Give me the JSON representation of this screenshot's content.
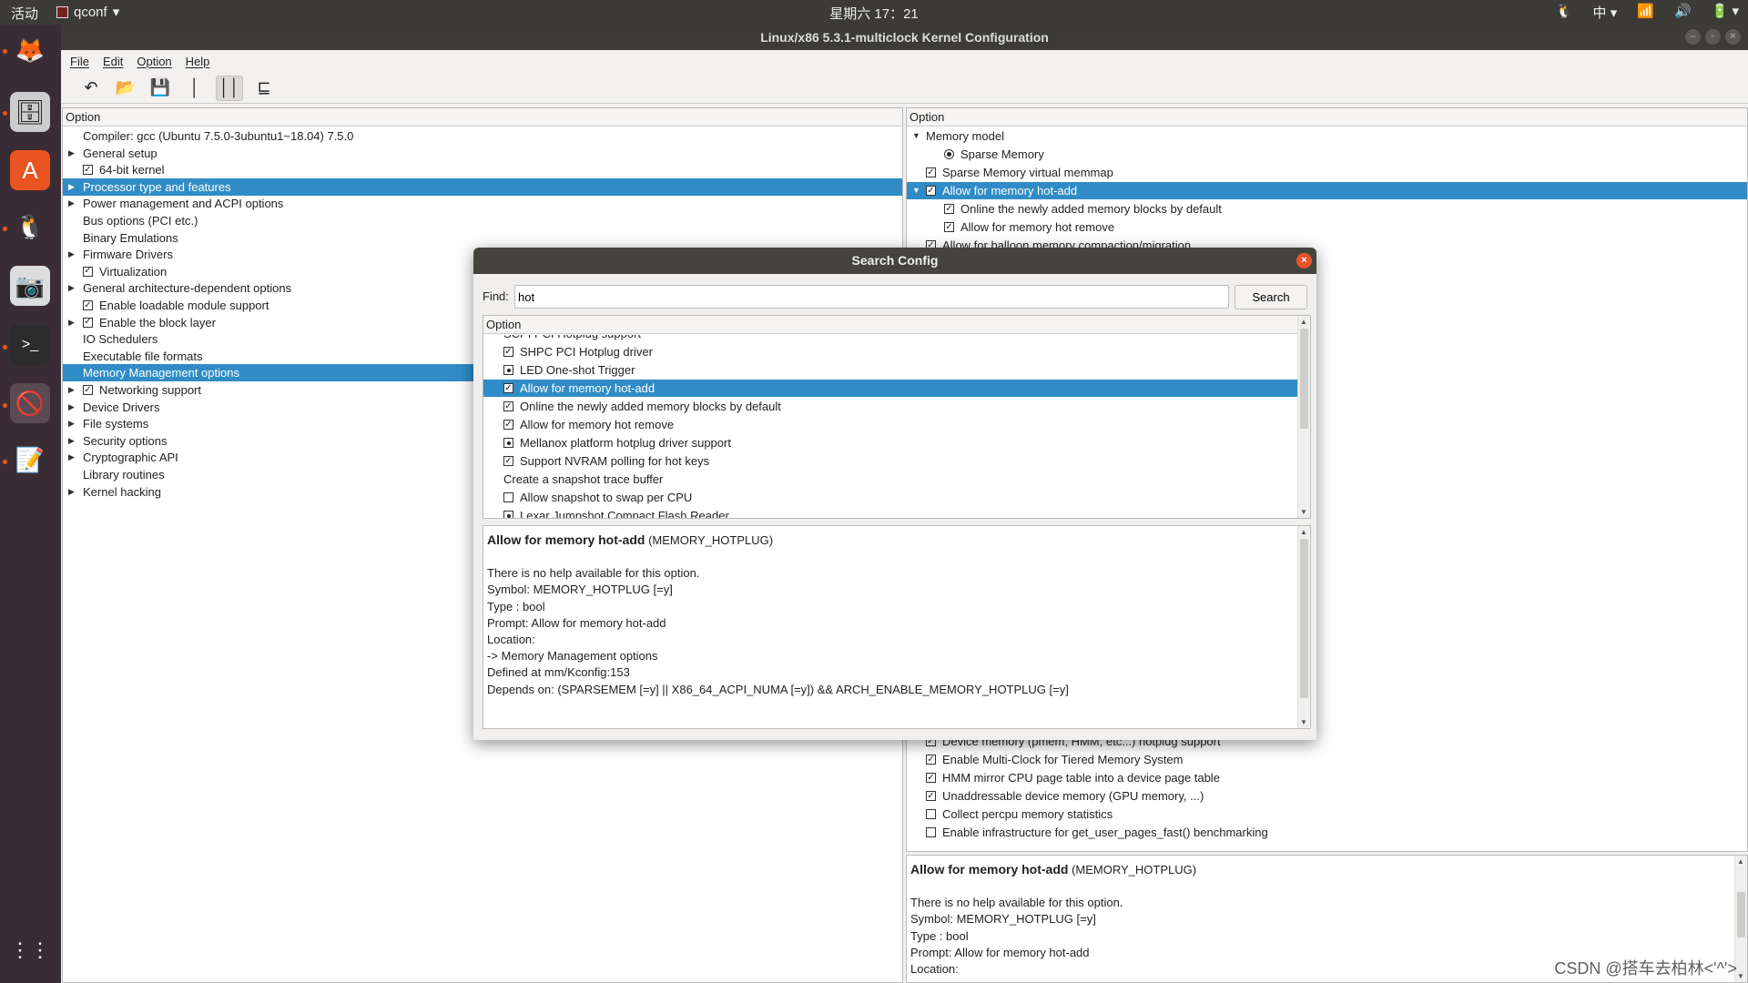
{
  "topbar": {
    "activities": "活动",
    "app_name": "qconf",
    "clock": "星期六 17：21",
    "input_method": "中"
  },
  "window": {
    "title": "Linux/x86 5.3.1-multiclock Kernel Configuration"
  },
  "menu": [
    "File",
    "Edit",
    "Option",
    "Help"
  ],
  "toolbar": {
    "icons": [
      "undo-icon",
      "open-folder-icon",
      "save-icon",
      "single-view-icon",
      "split-view-icon",
      "full-view-icon"
    ],
    "active": "split-view-icon"
  },
  "left": {
    "header": "Option",
    "rows": [
      {
        "label": "Compiler: gcc (Ubuntu 7.5.0-3ubuntu1~18.04) 7.5.0",
        "state": "none",
        "arrow": false
      },
      {
        "label": "General setup",
        "state": "none",
        "arrow": true
      },
      {
        "label": "64-bit kernel",
        "state": "checked",
        "arrow": false
      },
      {
        "label": "Processor type and features",
        "state": "none",
        "arrow": true,
        "selected": true
      },
      {
        "label": "Power management and ACPI options",
        "state": "none",
        "arrow": true
      },
      {
        "label": "Bus options (PCI etc.)",
        "state": "none",
        "arrow": false
      },
      {
        "label": "Binary Emulations",
        "state": "none",
        "arrow": false
      },
      {
        "label": "Firmware Drivers",
        "state": "none",
        "arrow": true
      },
      {
        "label": "Virtualization",
        "state": "checked",
        "arrow": false
      },
      {
        "label": "General architecture-dependent options",
        "state": "none",
        "arrow": true
      },
      {
        "label": "Enable loadable module support",
        "state": "checked",
        "arrow": false
      },
      {
        "label": "Enable the block layer",
        "state": "checked",
        "arrow": true
      },
      {
        "label": "IO Schedulers",
        "state": "none",
        "arrow": false
      },
      {
        "label": "Executable file formats",
        "state": "none",
        "arrow": false
      },
      {
        "label": "Memory Management options",
        "state": "none",
        "arrow": false,
        "selected": true
      },
      {
        "label": "Networking support",
        "state": "checked",
        "arrow": true
      },
      {
        "label": "Device Drivers",
        "state": "none",
        "arrow": true
      },
      {
        "label": "File systems",
        "state": "none",
        "arrow": true
      },
      {
        "label": "Security options",
        "state": "none",
        "arrow": true
      },
      {
        "label": "Cryptographic API",
        "state": "none",
        "arrow": true
      },
      {
        "label": "Library routines",
        "state": "none",
        "arrow": false
      },
      {
        "label": "Kernel hacking",
        "state": "none",
        "arrow": true
      }
    ]
  },
  "right": {
    "header": "Option",
    "rows_top": [
      {
        "label": "Memory model",
        "state": "none",
        "indent": 0,
        "expanded": true
      },
      {
        "label": "Sparse Memory",
        "state": "radio",
        "indent": 1
      },
      {
        "label": "Sparse Memory virtual memmap",
        "state": "checked",
        "indent": 0
      },
      {
        "label": "Allow for memory hot-add",
        "state": "checked",
        "indent": 0,
        "expanded": true,
        "selected": true
      },
      {
        "label": "Online the newly added memory blocks by default",
        "state": "checked",
        "indent": 1
      },
      {
        "label": "Allow for memory hot remove",
        "state": "checked",
        "indent": 1
      },
      {
        "label": "Allow for balloon memory compaction/migration",
        "state": "checked",
        "indent": 0
      }
    ],
    "rows_bottom": [
      {
        "label": "Device memory (pmem, HMM, etc...) hotplug support",
        "state": "checked"
      },
      {
        "label": "Enable Multi-Clock for Tiered Memory System",
        "state": "checked"
      },
      {
        "label": "HMM mirror CPU page table into a device page table",
        "state": "checked"
      },
      {
        "label": "Unaddressable device memory (GPU memory, ...)",
        "state": "checked"
      },
      {
        "label": "Collect percpu memory statistics",
        "state": "unchecked"
      },
      {
        "label": "Enable infrastructure for get_user_pages_fast() benchmarking",
        "state": "unchecked"
      }
    ],
    "help": {
      "title": "Allow for memory hot-add",
      "symbol_tag": "(MEMORY_HOTPLUG)",
      "lines": [
        "There is no help available for this option.",
        "Symbol: MEMORY_HOTPLUG [=y]",
        "Type : bool",
        "Prompt: Allow for memory hot-add",
        "Location:"
      ]
    }
  },
  "dialog": {
    "title": "Search Config",
    "find_label": "Find:",
    "find_value": "hot",
    "search_button": "Search",
    "list_header": "Option",
    "partial_row": "SCPI PCI Hotplug support",
    "rows": [
      {
        "label": "SHPC PCI Hotplug driver",
        "state": "checked"
      },
      {
        "label": "LED One-shot Trigger",
        "state": "module"
      },
      {
        "label": "Allow for memory hot-add",
        "state": "checked",
        "selected": true
      },
      {
        "label": "Online the newly added memory blocks by default",
        "state": "checked"
      },
      {
        "label": "Allow for memory hot remove",
        "state": "checked"
      },
      {
        "label": "Mellanox platform hotplug driver support",
        "state": "module"
      },
      {
        "label": "Support NVRAM polling for hot keys",
        "state": "checked"
      },
      {
        "label": "Create a snapshot trace buffer",
        "state": "none"
      },
      {
        "label": "Allow snapshot to swap per CPU",
        "state": "unchecked"
      },
      {
        "label": "Lexar Jumpshot Compact Flash Reader",
        "state": "module"
      }
    ],
    "help": {
      "title": "Allow for memory hot-add",
      "symbol_tag": "(MEMORY_HOTPLUG)",
      "lines": [
        "There is no help available for this option.",
        "Symbol: MEMORY_HOTPLUG [=y]",
        "Type : bool",
        "Prompt: Allow for memory hot-add",
        "Location:",
        "-> Memory Management options",
        "Defined at mm/Kconfig:153",
        "Depends on: (SPARSEMEM [=y] || X86_64_ACPI_NUMA [=y]) && ARCH_ENABLE_MEMORY_HOTPLUG [=y]"
      ]
    }
  },
  "watermark": "CSDN @搭车去柏林<'^'>",
  "colors": {
    "selection": "#308cc6",
    "topbar": "#3b3a36",
    "dock": "#3a2c34",
    "close": "#e8542a"
  }
}
